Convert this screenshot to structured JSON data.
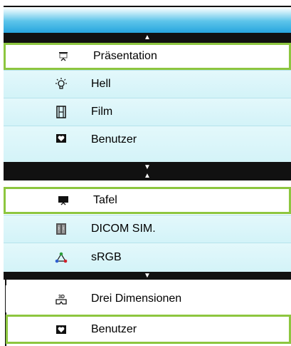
{
  "up_arrow": "▲",
  "down_arrow": "▼",
  "group1": [
    {
      "label": "Präsentation",
      "icon": "presentation-icon",
      "selected": true
    },
    {
      "label": "Hell",
      "icon": "sun-icon",
      "selected": false
    },
    {
      "label": "Film",
      "icon": "film-icon",
      "selected": false
    },
    {
      "label": "Benutzer",
      "icon": "heart-icon",
      "selected": false
    }
  ],
  "group2": [
    {
      "label": "Tafel",
      "icon": "blackboard-icon",
      "selected": true
    },
    {
      "label": "DICOM SIM.",
      "icon": "xray-icon",
      "selected": false
    },
    {
      "label": "sRGB",
      "icon": "rgb-triangle-icon",
      "selected": false
    }
  ],
  "group3": [
    {
      "label": "Drei Dimensionen",
      "icon": "3d-icon",
      "selected": false
    },
    {
      "label": "Benutzer",
      "icon": "heart-icon",
      "selected": true
    }
  ],
  "colors": {
    "accent": "#8dc63f",
    "header": "#27a6de",
    "row_bg": "#d9f5f9"
  }
}
